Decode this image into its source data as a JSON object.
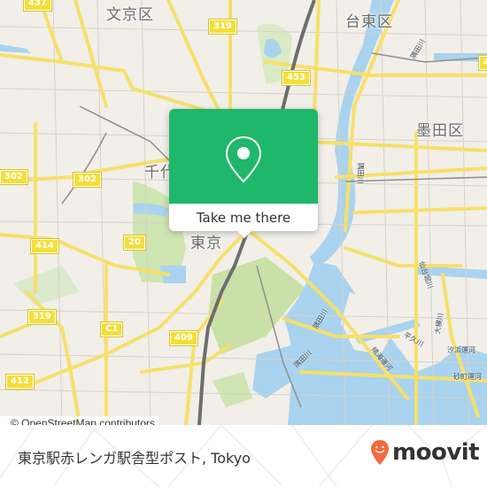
{
  "map": {
    "districts": [
      {
        "id": "bunkyo",
        "label": "文京区"
      },
      {
        "id": "taito",
        "label": "台東区"
      },
      {
        "id": "sumida",
        "label": "墨田区"
      },
      {
        "id": "chiyoda",
        "label": "千代"
      },
      {
        "id": "tokyo",
        "label": "東京"
      }
    ],
    "route_shields": [
      {
        "id": "r437",
        "label": "437"
      },
      {
        "id": "r319-top",
        "label": "319"
      },
      {
        "id": "r453",
        "label": "453"
      },
      {
        "id": "r302-left",
        "label": "302"
      },
      {
        "id": "r302-mid",
        "label": "302"
      },
      {
        "id": "r414",
        "label": "414"
      },
      {
        "id": "r20",
        "label": "20"
      },
      {
        "id": "r319-left",
        "label": "319"
      },
      {
        "id": "rC1",
        "label": "C1"
      },
      {
        "id": "r409",
        "label": "409"
      },
      {
        "id": "r412",
        "label": "412"
      },
      {
        "id": "r4-edge",
        "label": "4"
      }
    ],
    "water_labels": [
      {
        "id": "sumida-river-1",
        "label": "隅田川"
      },
      {
        "id": "sumida-river-2",
        "label": "隅田川"
      },
      {
        "id": "sumida-river-3",
        "label": "隅田川"
      },
      {
        "id": "sumida-river-4",
        "label": "隅田川"
      },
      {
        "id": "heikyu-river",
        "label": "平久川"
      },
      {
        "id": "oyoko-river",
        "label": "大横川"
      },
      {
        "id": "harumi-canal",
        "label": "晴海運河"
      },
      {
        "id": "shiohama-canal",
        "label": "汐浜運河"
      },
      {
        "id": "sunamura-canal",
        "label": "砂町運河"
      },
      {
        "id": "sendaibori",
        "label": "仙台堀川"
      }
    ],
    "attribution": "© OpenStreetMap contributors"
  },
  "popup": {
    "icon": "map-pin-icon",
    "action_label": "Take me there",
    "color": "#1fb76a"
  },
  "footer": {
    "place_name": "東京駅赤レンガ駅舎型ポスト, Tokyo",
    "brand": "moovit",
    "brand_color": "#f26a3d"
  }
}
